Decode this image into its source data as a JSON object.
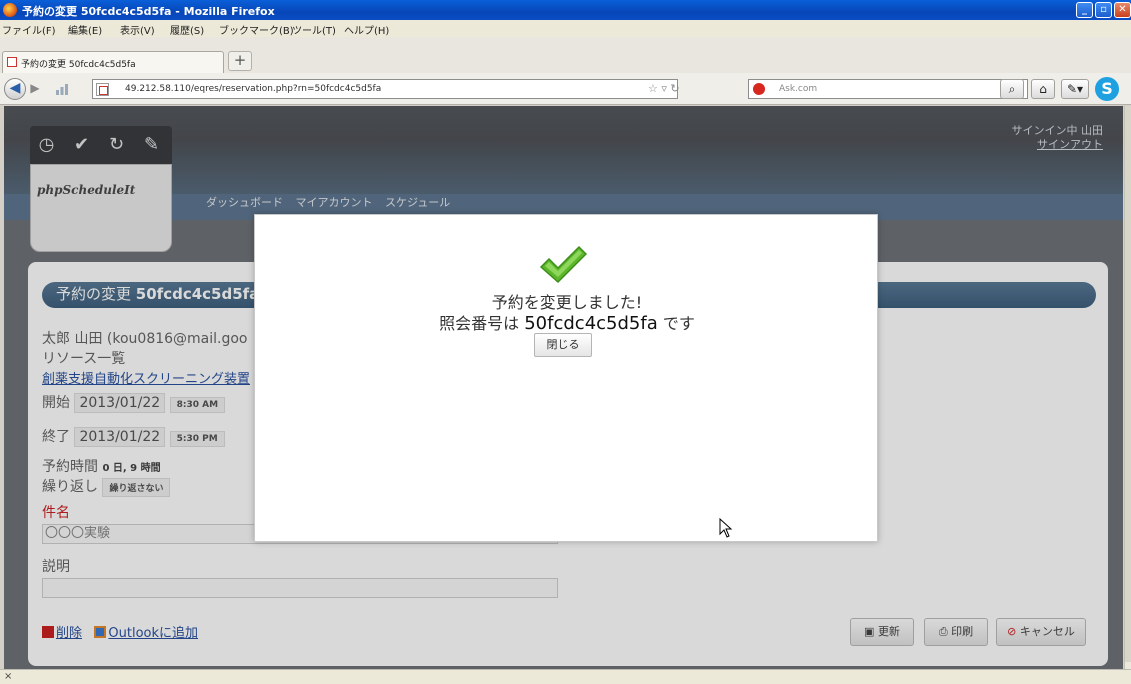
{
  "window": {
    "title": "予約の変更 50fcdc4c5d5fa - Mozilla Firefox"
  },
  "menu": [
    "ファイル(F)",
    "編集(E)",
    "表示(V)",
    "履歴(S)",
    "ブックマーク(B)",
    "ツール(T)",
    "ヘルプ(H)"
  ],
  "tab": {
    "label": "予約の変更 50fcdc4c5d5fa",
    "new_tab": "+"
  },
  "nav": {
    "url": "49.212.58.110/eqres/reservation.php?rn=50fcdc4c5d5fa",
    "search_placeholder": "Ask.com"
  },
  "header": {
    "signin_text": "サインイン中 山田",
    "signout_link": "サインアウト",
    "logo": "phpScheduleIt",
    "nav_links": [
      "ダッシュボード",
      "マイアカウント",
      "スケジュール"
    ]
  },
  "form": {
    "title_prefix": "予約の変更",
    "title_ref": "50fcdc4c5d5fa",
    "user_line": "太郎 山田 (kou0816@mail.goo",
    "resources_label": "リソース一覧",
    "resource_link": "創薬支援自動化スクリーニング装置",
    "start_label": "開始",
    "start_date": "2013/01/22",
    "start_time": "8:30 AM",
    "end_label": "終了",
    "end_date": "2013/01/22",
    "end_time": "5:30 PM",
    "duration_label": "予約時間",
    "duration_value": "0 日, 9 時間",
    "repeat_label": "繰り返し",
    "repeat_value": "繰り返さない",
    "subject_label": "件名",
    "subject_value": "〇〇〇実験",
    "description_label": "説明",
    "description_value": "",
    "delete_link": "削除",
    "outlook_link": "Outlookに追加",
    "update_button": "更新",
    "print_button": "印刷",
    "cancel_button": "キャンセル"
  },
  "modal": {
    "message": "予約を変更しました!",
    "ref_prefix": "照会番号は",
    "ref_number": "50fcdc4c5d5fa",
    "ref_suffix": "です",
    "close_button": "閉じる"
  },
  "status": {
    "text": "×"
  },
  "colors": {
    "header_blue": "#5e7791",
    "title_pill": "#4a6c8b",
    "check_green": "#5db72b",
    "danger_red": "#cc2222"
  }
}
